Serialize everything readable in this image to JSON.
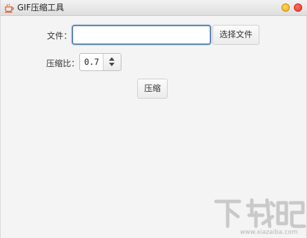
{
  "window": {
    "title": "GIF压缩工具",
    "app_icon": "coffee-cup-icon",
    "controls": [
      "minimize-button",
      "close-button"
    ],
    "colors": {
      "minimize": "#f5b127",
      "close": "#e8473a"
    }
  },
  "form": {
    "file_label": "文件：",
    "file_input_value": "",
    "file_input_placeholder": "",
    "select_file_label": "选择文件",
    "ratio_label": "压缩比：",
    "ratio_value": "0.7",
    "compress_label": "压缩"
  },
  "watermark": {
    "logo_text": "下载吧",
    "url": "www.xiazaiba.com"
  }
}
